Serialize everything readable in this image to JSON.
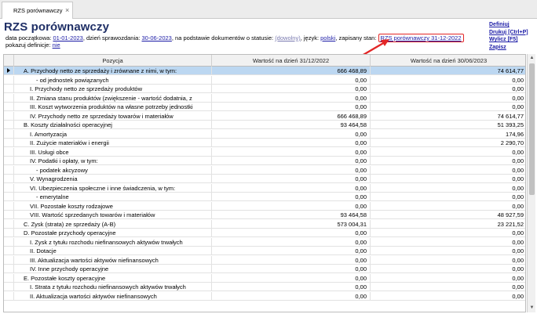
{
  "tab": {
    "label": "RZS porównawczy",
    "close": "×"
  },
  "header": {
    "title": "RZS porównawczy",
    "label_start": "data początkowa: ",
    "start_date": "01-01-2023",
    "label_report": ", dzień sprawozdania: ",
    "report_date": "30-06-2023",
    "label_status": ", na podstawie dokumentów o statusie: ",
    "status": "(dowolny)",
    "label_lang": ", język: ",
    "language": "polski",
    "label_saved": ", zapisany stan: ",
    "saved_state": "RZS porównawczy 31-12-2022",
    "label_defs": "pokazuj definicje: ",
    "defs_value": "nie"
  },
  "actions": {
    "definitions": "Definiuj",
    "print": "Drukuj [Ctrl+P]",
    "calculate": "Wylicz [F5]",
    "save": "Zapisz"
  },
  "accent_color": "#e32626",
  "table": {
    "columns": [
      "Pozycja",
      "Wartość na dzień 31/12/2022",
      "Wartość na dzień 30/06/2023"
    ],
    "rows": [
      {
        "label": "A. Przychody netto ze sprzedaży i zrównane z nimi, w tym:",
        "v1": "666 468,89",
        "v2": "74 614,77",
        "indent": 0
      },
      {
        "label": "- od jednostek powiązanych",
        "v1": "0,00",
        "v2": "0,00",
        "indent": 2
      },
      {
        "label": "I. Przychody netto ze sprzedaży produktów",
        "v1": "0,00",
        "v2": "0,00",
        "indent": 1
      },
      {
        "label": "II. Zmiana stanu produktów (zwiększenie - wartość dodatnia, z",
        "v1": "0,00",
        "v2": "0,00",
        "indent": 1
      },
      {
        "label": "III. Koszt wytworzenia produktów na własne potrzeby jednostki",
        "v1": "0,00",
        "v2": "0,00",
        "indent": 1
      },
      {
        "label": "IV. Przychody netto ze sprzedaży towarów i materiałów",
        "v1": "666 468,89",
        "v2": "74 614,77",
        "indent": 1
      },
      {
        "label": "B. Koszty działalności operacyjnej",
        "v1": "93 464,58",
        "v2": "51 393,25",
        "indent": 0
      },
      {
        "label": "I. Amortyzacja",
        "v1": "0,00",
        "v2": "174,96",
        "indent": 1
      },
      {
        "label": "II. Zużycie materiałów i energii",
        "v1": "0,00",
        "v2": "2 290,70",
        "indent": 1
      },
      {
        "label": "III. Usługi obce",
        "v1": "0,00",
        "v2": "0,00",
        "indent": 1
      },
      {
        "label": "IV. Podatki i opłaty, w tym:",
        "v1": "0,00",
        "v2": "0,00",
        "indent": 1
      },
      {
        "label": "- podatek akcyzowy",
        "v1": "0,00",
        "v2": "0,00",
        "indent": 2
      },
      {
        "label": "V. Wynagrodzenia",
        "v1": "0,00",
        "v2": "0,00",
        "indent": 1
      },
      {
        "label": "VI. Ubezpieczenia społeczne i inne świadczenia, w tym:",
        "v1": "0,00",
        "v2": "0,00",
        "indent": 1
      },
      {
        "label": "- emerytalne",
        "v1": "0,00",
        "v2": "0,00",
        "indent": 2
      },
      {
        "label": "VII. Pozostałe koszty rodzajowe",
        "v1": "0,00",
        "v2": "0,00",
        "indent": 1
      },
      {
        "label": "VIII. Wartość sprzedanych towarów i materiałów",
        "v1": "93 464,58",
        "v2": "48 927,59",
        "indent": 1
      },
      {
        "label": "C. Zysk (strata) ze sprzedaży (A-B)",
        "v1": "573 004,31",
        "v2": "23 221,52",
        "indent": 0
      },
      {
        "label": "D. Pozostałe przychody operacyjne",
        "v1": "0,00",
        "v2": "0,00",
        "indent": 0
      },
      {
        "label": "I. Zysk z tytułu rozchodu niefinansowych aktywów trwałych",
        "v1": "0,00",
        "v2": "0,00",
        "indent": 1
      },
      {
        "label": "II. Dotacje",
        "v1": "0,00",
        "v2": "0,00",
        "indent": 1
      },
      {
        "label": "III. Aktualizacja wartości aktywów niefinansowych",
        "v1": "0,00",
        "v2": "0,00",
        "indent": 1
      },
      {
        "label": "IV. Inne przychody operacyjne",
        "v1": "0,00",
        "v2": "0,00",
        "indent": 1
      },
      {
        "label": "E. Pozostałe koszty operacyjne",
        "v1": "0,00",
        "v2": "0,00",
        "indent": 0
      },
      {
        "label": "I. Strata z tytułu rozchodu niefinansowych aktywów trwałych",
        "v1": "0,00",
        "v2": "0,00",
        "indent": 1
      },
      {
        "label": "II. Aktualizacja wartości aktywów niefinansowych",
        "v1": "0,00",
        "v2": "0,00",
        "indent": 1
      }
    ]
  }
}
